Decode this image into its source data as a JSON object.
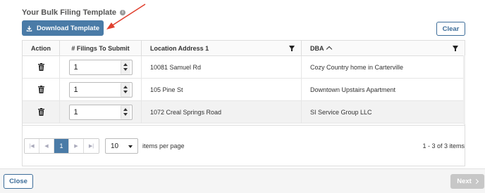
{
  "section": {
    "title": "Your Bulk Filing Template",
    "info_icon": "info-icon"
  },
  "toolbar": {
    "download_label": "Download Template",
    "download_icon": "download-icon",
    "clear_label": "Clear"
  },
  "grid": {
    "columns": {
      "action": "Action",
      "filings": "# Filings To Submit",
      "address": "Location Address 1",
      "dba": "DBA"
    },
    "rows": [
      {
        "filings": "1",
        "address": "10081 Samuel Rd",
        "dba": "Cozy Country home in Carterville"
      },
      {
        "filings": "1",
        "address": "105 Pine St",
        "dba": "Downtown Upstairs Apartment"
      },
      {
        "filings": "1",
        "address": "1072 Creal Springs Road",
        "dba": "SI Service Group LLC"
      }
    ]
  },
  "pager": {
    "current_page": "1",
    "page_size": "10",
    "per_page_label": "items per page",
    "range_text": "1 - 3 of 3 items"
  },
  "footer": {
    "close_label": "Close",
    "next_label": "Next"
  },
  "colors": {
    "primary": "#4a7ba7",
    "annotation_arrow": "#e0402f",
    "disabled": "#c7c7c7"
  }
}
